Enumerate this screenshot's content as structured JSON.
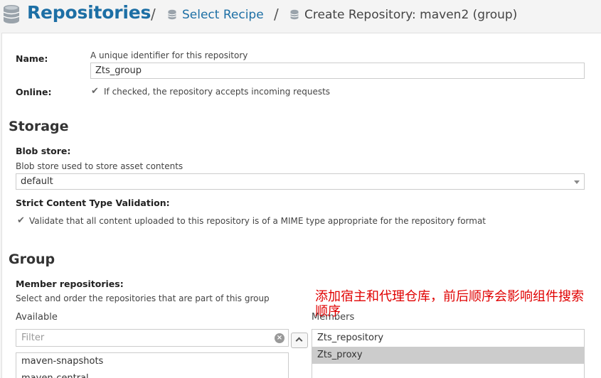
{
  "breadcrumb": {
    "title": "Repositories",
    "separator": "/",
    "link": "Select Recipe",
    "current": "Create Repository: maven2 (group)"
  },
  "form": {
    "name_label": "Name:",
    "name_help": "A unique identifier for this repository",
    "name_value": "Zts_group",
    "online_label": "Online:",
    "online_checkbox_label": "If checked, the repository accepts incoming requests",
    "online_checked": true
  },
  "storage": {
    "section_title": "Storage",
    "blob_label": "Blob store:",
    "blob_help": "Blob store used to store asset contents",
    "blob_value": "default",
    "strict_label": "Strict Content Type Validation:",
    "strict_checkbox_label": "Validate that all content uploaded to this repository is of a MIME type appropriate for the repository format",
    "strict_checked": true
  },
  "group": {
    "section_title": "Group",
    "members_label": "Member repositories:",
    "members_help": "Select and order the repositories that are part of this group",
    "available_label": "Available",
    "members_col_label": "Members",
    "filter_placeholder": "Filter",
    "available_items": [
      "maven-snapshots",
      "maven-central"
    ],
    "member_items": [
      "Zts_repository",
      "Zts_proxy"
    ],
    "selected_member": "Zts_proxy"
  },
  "annotation": {
    "text": "添加宿主和代理仓库，前后顺序会影响组件搜索顺序",
    "color": "#e00000"
  },
  "icons": {
    "repo_icon": "database-icon",
    "clear_icon": "clear-circle-icon",
    "move_icon": "chevron-up-icon"
  }
}
